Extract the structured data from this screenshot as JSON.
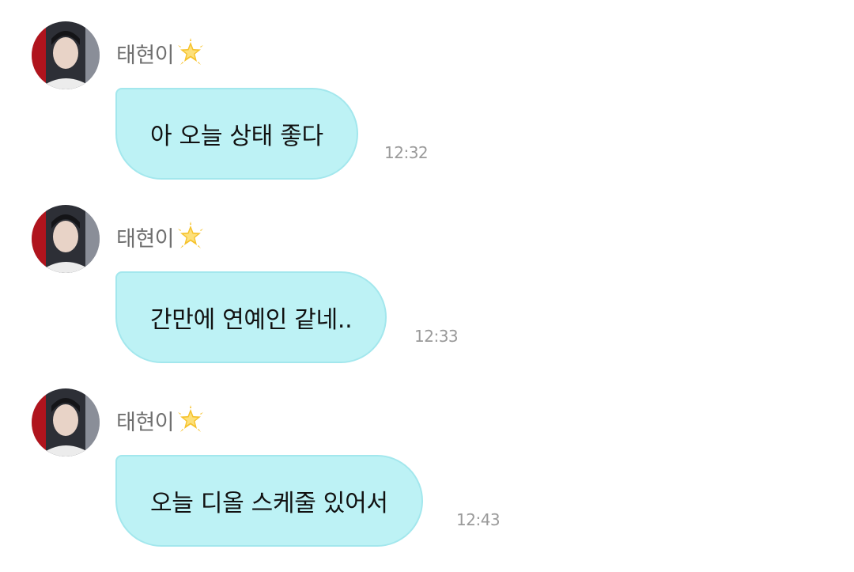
{
  "messages": [
    {
      "sender": "태현이",
      "text": "아 오늘 상태 좋다",
      "time": "12:32"
    },
    {
      "sender": "태현이",
      "text": "간만에 연예인 같네..",
      "time": "12:33"
    },
    {
      "sender": "태현이",
      "text": "오늘 디올 스케줄 있어서",
      "time": "12:43"
    }
  ],
  "icons": {
    "sender_badge": "sparkling-star-icon",
    "avatar": "profile-photo"
  },
  "colors": {
    "bubble": "#bdf2f5",
    "bubble_border": "#a3e7ed",
    "sender_text": "#6f6f6f",
    "time_text": "#9a9a9a",
    "message_text": "#111111"
  }
}
